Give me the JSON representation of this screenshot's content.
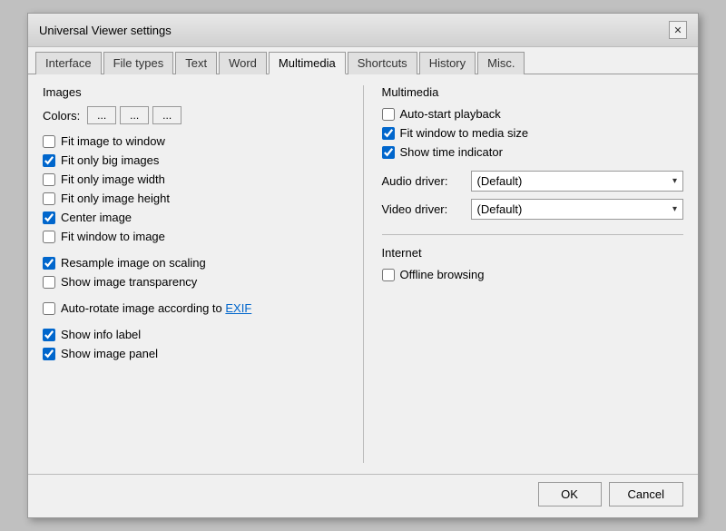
{
  "window": {
    "title": "Universal Viewer settings",
    "close_label": "✕"
  },
  "tabs": [
    {
      "id": "interface",
      "label": "Interface"
    },
    {
      "id": "filetypes",
      "label": "File types"
    },
    {
      "id": "text",
      "label": "Text"
    },
    {
      "id": "word",
      "label": "Word"
    },
    {
      "id": "multimedia",
      "label": "Multimedia",
      "active": true
    },
    {
      "id": "shortcuts",
      "label": "Shortcuts"
    },
    {
      "id": "history",
      "label": "History"
    },
    {
      "id": "misc",
      "label": "Misc."
    }
  ],
  "images_section": {
    "label": "Images",
    "colors_label": "Colors:",
    "color_btn1": "...",
    "color_btn2": "...",
    "color_btn3": "...",
    "checkboxes": [
      {
        "id": "fit_window",
        "label": "Fit image to window",
        "checked": false
      },
      {
        "id": "fit_big",
        "label": "Fit only big images",
        "checked": true
      },
      {
        "id": "fit_width",
        "label": "Fit only image width",
        "checked": false
      },
      {
        "id": "fit_height",
        "label": "Fit only image height",
        "checked": false
      },
      {
        "id": "center",
        "label": "Center image",
        "checked": true
      },
      {
        "id": "fit_win_img",
        "label": "Fit window to image",
        "checked": false
      }
    ],
    "checkboxes2": [
      {
        "id": "resample",
        "label": "Resample image on scaling",
        "checked": true
      },
      {
        "id": "transparency",
        "label": "Show image transparency",
        "checked": false
      }
    ],
    "checkboxes3": [
      {
        "id": "autorotate",
        "label": "Auto-rotate image according to ",
        "link": "EXIF",
        "checked": false
      }
    ],
    "checkboxes4": [
      {
        "id": "info_label",
        "label": "Show info label",
        "checked": true
      },
      {
        "id": "image_panel",
        "label": "Show image panel",
        "checked": true
      }
    ]
  },
  "multimedia_section": {
    "label": "Multimedia",
    "checkboxes": [
      {
        "id": "autostart",
        "label": "Auto-start playback",
        "checked": false
      },
      {
        "id": "fit_media",
        "label": "Fit window to media size",
        "checked": true
      },
      {
        "id": "time_indicator",
        "label": "Show time indicator",
        "checked": true
      }
    ],
    "audio_driver": {
      "label": "Audio driver:",
      "value": "(Default)"
    },
    "video_driver": {
      "label": "Video driver:",
      "value": "(Default)"
    }
  },
  "internet_section": {
    "label": "Internet",
    "checkboxes": [
      {
        "id": "offline",
        "label": "Offline browsing",
        "checked": false
      }
    ]
  },
  "footer": {
    "ok_label": "OK",
    "cancel_label": "Cancel"
  }
}
